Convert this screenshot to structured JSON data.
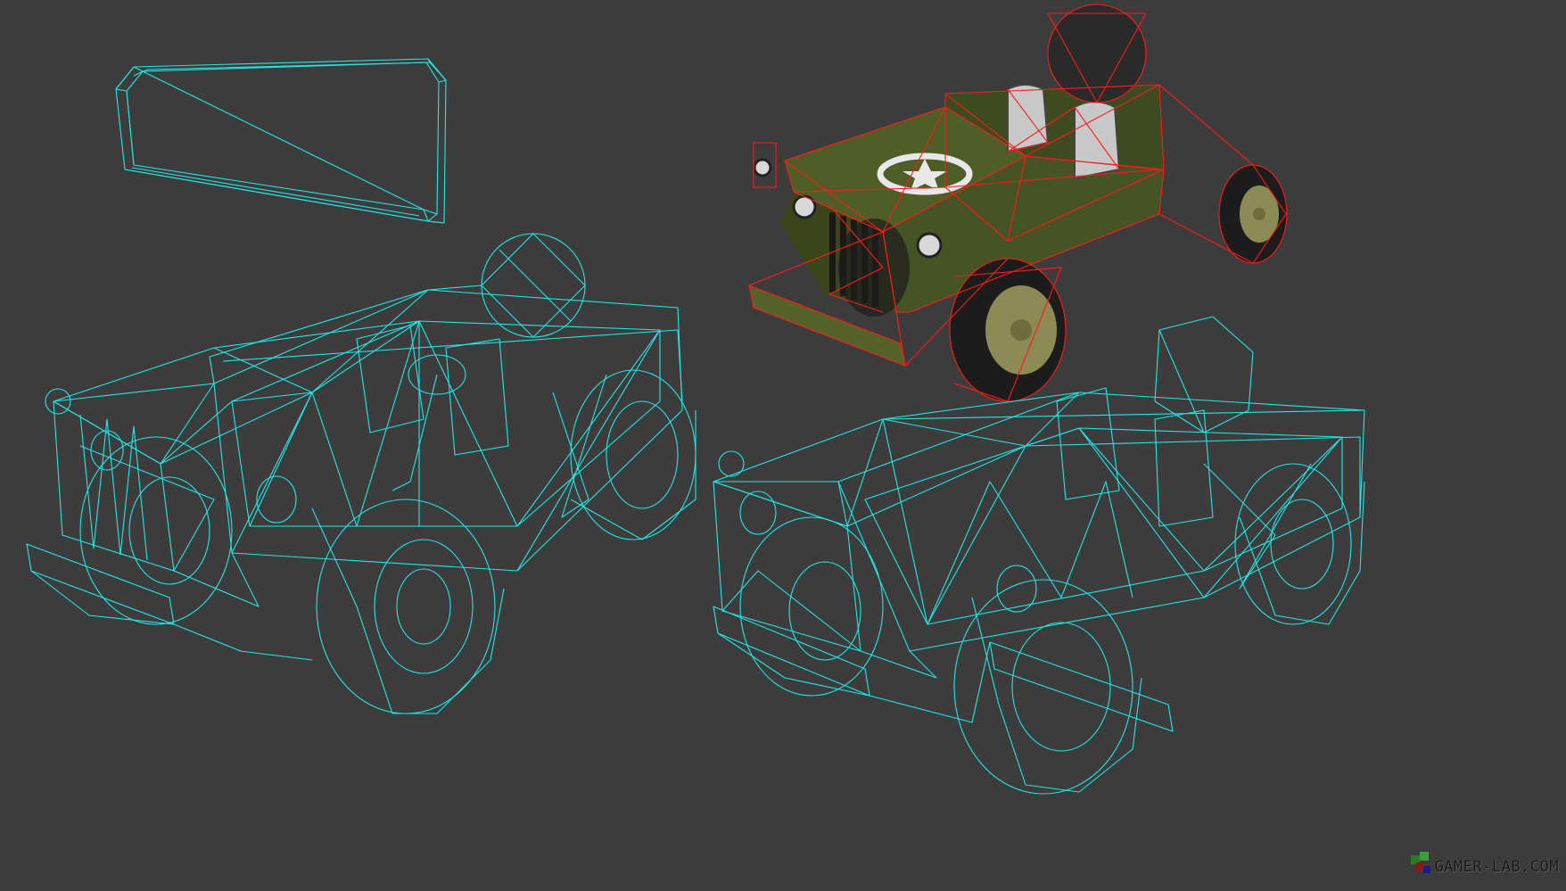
{
  "scene": {
    "background_color": "#3c3c3c",
    "wireframe_color": "#22e6e6",
    "collision_wire_color": "#ff1a1a",
    "body_color": "#4a5a28",
    "emblem_color": "#e8e8e8"
  },
  "panels": [
    {
      "name": "windshield-wireframe",
      "icon": "windshield-wireframe-icon"
    },
    {
      "name": "jeep-textured-collision",
      "icon": "jeep-render-icon"
    },
    {
      "name": "jeep-wireframe-front",
      "icon": "jeep-wireframe-icon"
    },
    {
      "name": "jeep-wireframe-side",
      "icon": "jeep-wireframe-icon"
    }
  ],
  "watermark": {
    "text": "GAMER-LAB.COM",
    "logo_icon": "gamer-lab-logo-icon"
  }
}
